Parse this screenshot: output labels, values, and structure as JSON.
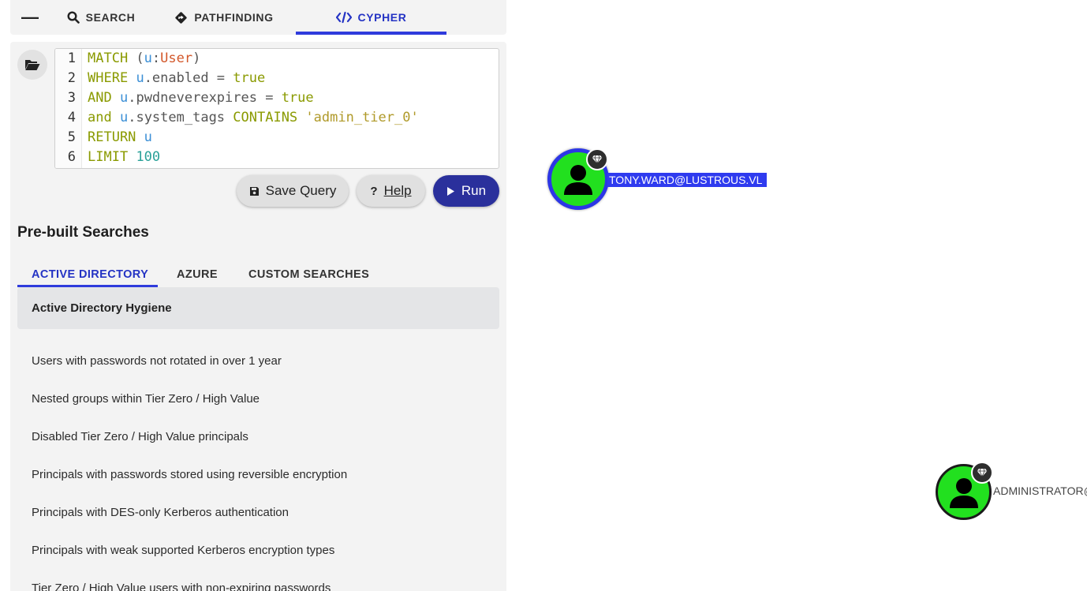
{
  "top_tabs": {
    "collapse_icon": "minus-icon",
    "search": {
      "label": "SEARCH",
      "icon": "search-icon"
    },
    "pathfinding": {
      "label": "PATHFINDING",
      "icon": "diamond-route-icon"
    },
    "cypher": {
      "label": "CYPHER",
      "icon": "code-icon"
    }
  },
  "editor": {
    "lines": [
      {
        "n": "1",
        "tokens": [
          [
            "kw",
            "MATCH"
          ],
          [
            "punc",
            " ("
          ],
          [
            "var",
            "u"
          ],
          [
            "punc",
            ":"
          ],
          [
            "lbl",
            "User"
          ],
          [
            "punc",
            ")"
          ]
        ]
      },
      {
        "n": "2",
        "tokens": [
          [
            "kw",
            "WHERE"
          ],
          [
            "punc",
            " "
          ],
          [
            "var",
            "u"
          ],
          [
            "punc",
            ".enabled = "
          ],
          [
            "kw",
            "true"
          ]
        ]
      },
      {
        "n": "3",
        "tokens": [
          [
            "kw",
            "AND"
          ],
          [
            "punc",
            " "
          ],
          [
            "var",
            "u"
          ],
          [
            "punc",
            ".pwdneverexpires = "
          ],
          [
            "kw",
            "true"
          ]
        ]
      },
      {
        "n": "4",
        "tokens": [
          [
            "kw",
            "and"
          ],
          [
            "punc",
            " "
          ],
          [
            "var",
            "u"
          ],
          [
            "punc",
            ".system_tags "
          ],
          [
            "kw",
            "CONTAINS"
          ],
          [
            "punc",
            " "
          ],
          [
            "str",
            "'admin_tier_0'"
          ]
        ]
      },
      {
        "n": "5",
        "tokens": [
          [
            "kw",
            "RETURN"
          ],
          [
            "punc",
            " "
          ],
          [
            "var",
            "u"
          ]
        ]
      },
      {
        "n": "6",
        "tokens": [
          [
            "kw",
            "LIMIT"
          ],
          [
            "punc",
            " "
          ],
          [
            "num",
            "100"
          ]
        ]
      }
    ]
  },
  "buttons": {
    "save": "Save Query",
    "help": "Help",
    "help_prefix": "?",
    "run": "Run"
  },
  "prebuilt": {
    "title": "Pre-built Searches",
    "tabs": [
      "ACTIVE DIRECTORY",
      "AZURE",
      "CUSTOM SEARCHES"
    ],
    "category": "Active Directory Hygiene",
    "queries": [
      "Users with passwords not rotated in over 1 year",
      "Nested groups within Tier Zero / High Value",
      "Disabled Tier Zero / High Value principals",
      "Principals with passwords stored using reversible encryption",
      "Principals with DES-only Kerberos authentication",
      "Principals with weak supported Kerberos encryption types",
      "Tier Zero / High Value users with non-expiring passwords"
    ]
  },
  "graph": {
    "nodes": [
      {
        "label": "TONY.WARD@LUSTROUS.VL",
        "selected": true,
        "icon": "user-icon",
        "badge_icon": "gem-icon"
      },
      {
        "label": "ADMINISTRATOR@",
        "selected": false,
        "icon": "user-icon",
        "badge_icon": "gem-icon"
      }
    ],
    "colors": {
      "node_fill": "#22e01f",
      "selected_border": "#2c36e6",
      "accent": "#2f3bdc"
    }
  }
}
